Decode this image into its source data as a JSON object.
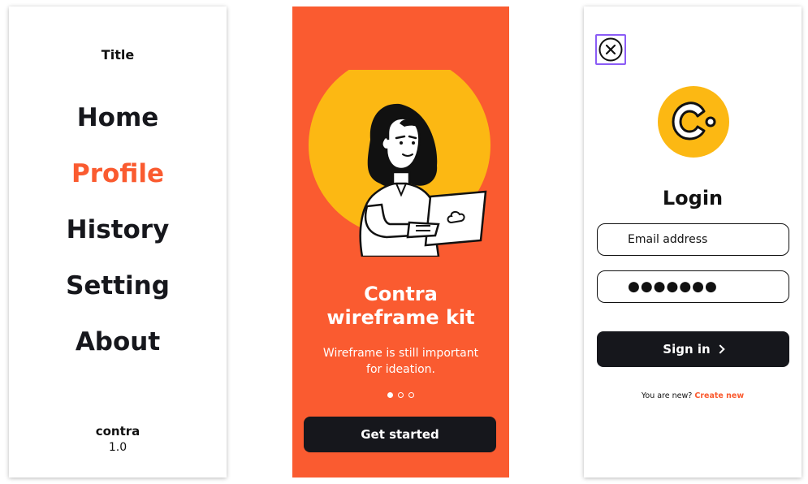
{
  "menu_screen": {
    "title": "Title",
    "items": [
      {
        "label": "Home",
        "active": false
      },
      {
        "label": "Profile",
        "active": true
      },
      {
        "label": "History",
        "active": false
      },
      {
        "label": "Setting",
        "active": false
      },
      {
        "label": "About",
        "active": false
      }
    ],
    "brand": "contra",
    "version": "1.0"
  },
  "onboarding_screen": {
    "title_line1": "Contra",
    "title_line2": "wireframe kit",
    "subtitle_line1": "Wireframe is still important",
    "subtitle_line2": "for ideation.",
    "pager": {
      "pages": 3,
      "current": 1
    },
    "cta_label": "Get started",
    "illustration": "woman-with-laptop"
  },
  "login_screen": {
    "close_icon": "close-icon",
    "logo": "contra-logo",
    "title": "Login",
    "email_placeholder": "Email address",
    "password_value": "●●●●●●●",
    "signin_label": "Sign in",
    "new_user_text": "You are new?",
    "create_link": "Create new"
  },
  "colors": {
    "accent": "#fa5b30",
    "dark": "#16171c",
    "yellow": "#fcb813",
    "focus": "#8b5cf6"
  }
}
